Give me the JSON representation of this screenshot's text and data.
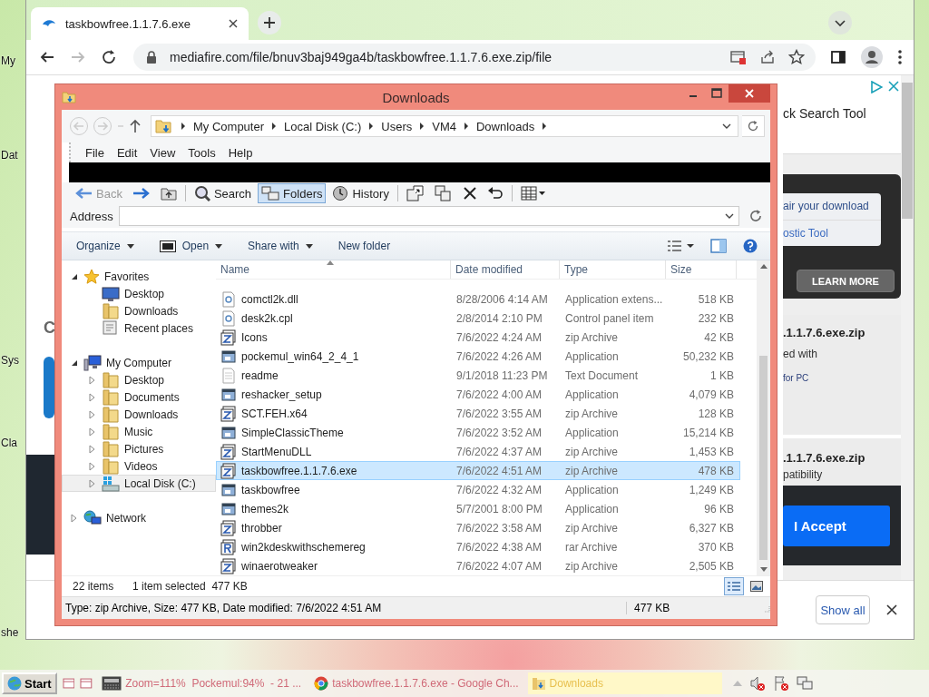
{
  "desktop": {
    "icon_labels": [
      "My",
      "Dat",
      "Sys",
      "Cla",
      "she"
    ]
  },
  "browser": {
    "tab": {
      "title": "taskbowfree.1.1.7.6.exe",
      "selected": true
    },
    "address": "mediafire.com/file/bnuv3baj949ga4b/taskbowfree.1.1.7.6.exe.zip/file",
    "page": {
      "left_fragment": "C",
      "ad_text": "ck Search Tool",
      "promo_lines": [
        "air your download",
        "ostic Tool"
      ],
      "learn_more": "LEARN MORE",
      "file_title": ".1.1.7.6.exe.zip",
      "file_line": "ed with",
      "file_link": "for PC",
      "file_title_2": ".1.1.7.6.exe.zip",
      "file_line_2": "patibility",
      "accept": "I Accept"
    },
    "downloads_bar": {
      "show_all": "Show all"
    }
  },
  "explorer": {
    "title": "Downloads",
    "breadcrumb": [
      "My Computer",
      "Local Disk (C:)",
      "Users",
      "VM4",
      "Downloads"
    ],
    "menu": [
      "File",
      "Edit",
      "View",
      "Tools",
      "Help"
    ],
    "toolbar": [
      {
        "kind": "back",
        "label": "Back",
        "disabled": true,
        "selected": false
      },
      {
        "kind": "forward",
        "disabled": false,
        "selected": false
      },
      {
        "kind": "up",
        "disabled": false,
        "selected": false
      },
      {
        "kind": "search",
        "label": "Search",
        "disabled": false,
        "selected": false
      },
      {
        "kind": "folders",
        "label": "Folders",
        "disabled": false,
        "selected": true
      },
      {
        "kind": "history",
        "label": "History",
        "disabled": false,
        "selected": false
      },
      {
        "kind": "move",
        "disabled": false,
        "selected": false
      },
      {
        "kind": "copy",
        "disabled": false,
        "selected": false
      },
      {
        "kind": "delete",
        "disabled": false,
        "selected": false
      },
      {
        "kind": "undo",
        "disabled": false,
        "selected": false
      },
      {
        "kind": "views",
        "disabled": false,
        "selected": false
      }
    ],
    "address_label": "Address",
    "commands": [
      {
        "label": "Organize",
        "kind": "menu"
      },
      {
        "label": "Open",
        "kind": "archive"
      },
      {
        "label": "Share with",
        "kind": "menu"
      },
      {
        "label": "New folder",
        "kind": "plain"
      }
    ],
    "nav": [
      {
        "label": "Favorites",
        "kind": "star",
        "expanded": true,
        "selected": false,
        "children": [
          {
            "label": "Desktop",
            "kind": "monitor",
            "selected": false
          },
          {
            "label": "Downloads",
            "kind": "folder",
            "selected": false
          },
          {
            "label": "Recent places",
            "kind": "recent",
            "selected": false
          }
        ]
      },
      {
        "label": "My Computer",
        "kind": "computer",
        "expanded": true,
        "selected": false,
        "children": [
          {
            "label": "Desktop",
            "kind": "folder",
            "expanded": false,
            "selected": false
          },
          {
            "label": "Documents",
            "kind": "folder",
            "expanded": false,
            "selected": false
          },
          {
            "label": "Downloads",
            "kind": "folder",
            "expanded": false,
            "selected": false
          },
          {
            "label": "Music",
            "kind": "folder",
            "expanded": false,
            "selected": false
          },
          {
            "label": "Pictures",
            "kind": "folder",
            "expanded": false,
            "selected": false
          },
          {
            "label": "Videos",
            "kind": "folder",
            "expanded": false,
            "selected": false
          },
          {
            "label": "Local Disk (C:)",
            "kind": "disk",
            "expanded": false,
            "selected": true
          }
        ]
      },
      {
        "label": "Network",
        "kind": "network",
        "expanded": false,
        "selected": false
      }
    ],
    "columns": [
      "Name",
      "Date modified",
      "Type",
      "Size"
    ],
    "rows": [
      {
        "name": "comctl2k.dll",
        "date": "8/28/2006 4:14 AM",
        "type": "Application extens...",
        "size": "518 KB",
        "kind": "settings",
        "selected": false
      },
      {
        "name": "desk2k.cpl",
        "date": "2/8/2014 2:10 PM",
        "type": "Control panel item",
        "size": "232 KB",
        "kind": "settings",
        "selected": false
      },
      {
        "name": "Icons",
        "date": "7/6/2022 4:24 AM",
        "type": "zip Archive",
        "size": "42 KB",
        "kind": "zip",
        "selected": false
      },
      {
        "name": "pockemul_win64_2_4_1",
        "date": "7/6/2022 4:26 AM",
        "type": "Application",
        "size": "50,232 KB",
        "kind": "app",
        "selected": false
      },
      {
        "name": "readme",
        "date": "9/1/2018 11:23 PM",
        "type": "Text Document",
        "size": "1 KB",
        "kind": "text",
        "selected": false
      },
      {
        "name": "reshacker_setup",
        "date": "7/6/2022 4:00 AM",
        "type": "Application",
        "size": "4,079 KB",
        "kind": "app",
        "selected": false
      },
      {
        "name": "SCT.FEH.x64",
        "date": "7/6/2022 3:55 AM",
        "type": "zip Archive",
        "size": "128 KB",
        "kind": "zip",
        "selected": false
      },
      {
        "name": "SimpleClassicTheme",
        "date": "7/6/2022 3:52 AM",
        "type": "Application",
        "size": "15,214 KB",
        "kind": "app",
        "selected": false
      },
      {
        "name": "StartMenuDLL",
        "date": "7/6/2022 4:37 AM",
        "type": "zip Archive",
        "size": "1,453 KB",
        "kind": "zip",
        "selected": false
      },
      {
        "name": "taskbowfree.1.1.7.6.exe",
        "date": "7/6/2022 4:51 AM",
        "type": "zip Archive",
        "size": "478 KB",
        "kind": "zip",
        "selected": true
      },
      {
        "name": "taskbowfree",
        "date": "7/6/2022 4:32 AM",
        "type": "Application",
        "size": "1,249 KB",
        "kind": "app",
        "selected": false
      },
      {
        "name": "themes2k",
        "date": "5/7/2001 8:00 PM",
        "type": "Application",
        "size": "96 KB",
        "kind": "app",
        "selected": false
      },
      {
        "name": "throbber",
        "date": "7/6/2022 3:58 AM",
        "type": "zip Archive",
        "size": "6,327 KB",
        "kind": "zip",
        "selected": false
      },
      {
        "name": "win2kdeskwithschemereg",
        "date": "7/6/2022 4:38 AM",
        "type": "rar Archive",
        "size": "370 KB",
        "kind": "rar",
        "selected": false
      },
      {
        "name": "winaerotweaker",
        "date": "7/6/2022 4:07 AM",
        "type": "zip Archive",
        "size": "2,505 KB",
        "kind": "zip",
        "selected": false
      }
    ],
    "status": {
      "count": "22 items",
      "selection": "1 item selected  477 KB"
    },
    "details": {
      "text": "Type: zip Archive, Size: 477 KB, Date modified: 7/6/2022 4:51 AM",
      "size": "477 KB"
    }
  },
  "taskbar": {
    "start": "Start",
    "tasks": [
      {
        "label": "Zoom=111%  Pockemul:94%  - 21 ...",
        "kind": "app",
        "selected": false
      },
      {
        "label": "taskbowfree.1.1.7.6.exe - Google Ch...",
        "kind": "browser",
        "selected": false
      },
      {
        "label": "Downloads",
        "kind": "folder",
        "selected": true
      }
    ]
  }
}
